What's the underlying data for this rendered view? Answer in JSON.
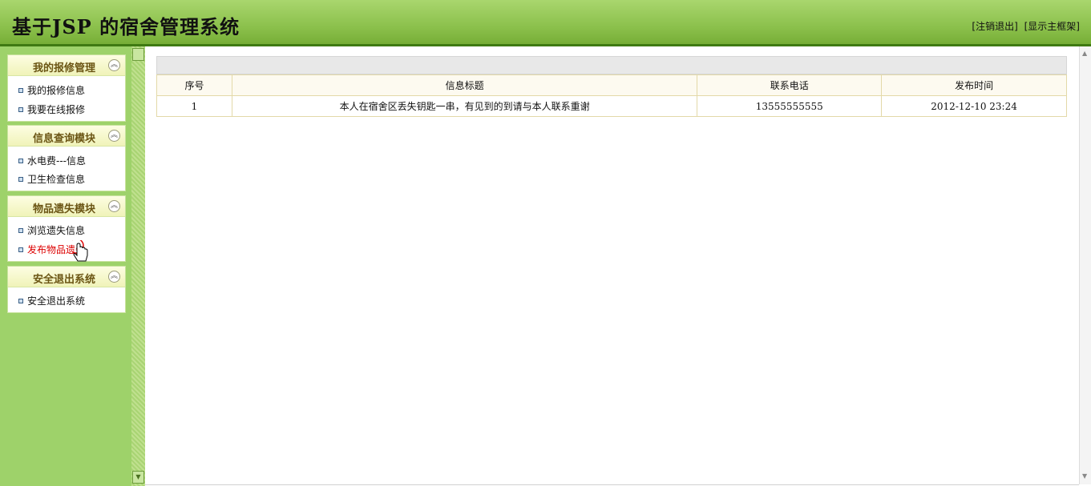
{
  "app_title": "基于JSP 的宿舍管理系统",
  "header_links": {
    "logout": "[注销退出]",
    "show_main_frame": "[显示主框架]"
  },
  "sidebar": {
    "panels": [
      {
        "title": "我的报修管理",
        "items": [
          "我的报修信息",
          "我要在线报修"
        ]
      },
      {
        "title": "信息查询模块",
        "items": [
          "水电费---信息",
          "卫生检查信息"
        ]
      },
      {
        "title": "物品遗失模块",
        "items": [
          "浏览遗失信息",
          "发布物品遗失"
        ]
      },
      {
        "title": "安全退出系统",
        "items": [
          "安全退出系统"
        ]
      }
    ],
    "active_item": "发布物品遗失",
    "collapse_symbol": "︽"
  },
  "table": {
    "headers": [
      "序号",
      "信息标题",
      "联系电话",
      "发布时间"
    ],
    "rows": [
      [
        "1",
        "本人在宿舍区丢失钥匙一串，有见到的到请与本人联系重谢",
        "13555555555",
        "2012-12-10 23:24"
      ]
    ]
  },
  "colors": {
    "header_green": "#8cc14d",
    "sidebar_green": "#9ed26a",
    "active_link": "#dd0000"
  }
}
